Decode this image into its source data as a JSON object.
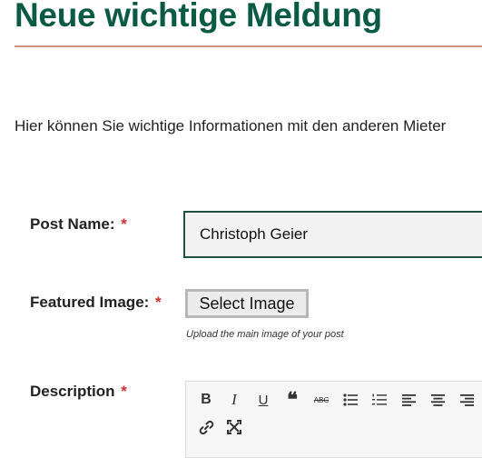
{
  "page": {
    "title": "Neue wichtige Meldung",
    "intro": "Hier können Sie wichtige Informationen mit den anderen Mieter"
  },
  "form": {
    "post_name": {
      "label": "Post Name:",
      "required_mark": "*",
      "value": "Christoph Geier"
    },
    "featured_image": {
      "label": "Featured Image:",
      "required_mark": "*",
      "button_label": "Select Image",
      "hint": "Upload the main image of your post"
    },
    "description": {
      "label": "Description",
      "required_mark": "*"
    }
  },
  "editor_toolbar": {
    "buttons": [
      {
        "icon": "bold-icon",
        "glyph": "B"
      },
      {
        "icon": "italic-icon",
        "glyph": "I"
      },
      {
        "icon": "underline-icon",
        "glyph": "U"
      },
      {
        "icon": "blockquote-icon",
        "glyph": "❝"
      },
      {
        "icon": "strikethrough-icon",
        "glyph": "ABC"
      },
      {
        "icon": "bulleted-list-icon"
      },
      {
        "icon": "numbered-list-icon"
      },
      {
        "icon": "align-left-icon"
      },
      {
        "icon": "align-center-icon"
      },
      {
        "icon": "align-right-icon"
      },
      {
        "icon": "link-icon"
      },
      {
        "icon": "fullscreen-icon"
      }
    ]
  },
  "colors": {
    "title": "#0b5a43",
    "rule": "#d3958a",
    "required": "#d0312d",
    "input_border": "#1d5140"
  }
}
